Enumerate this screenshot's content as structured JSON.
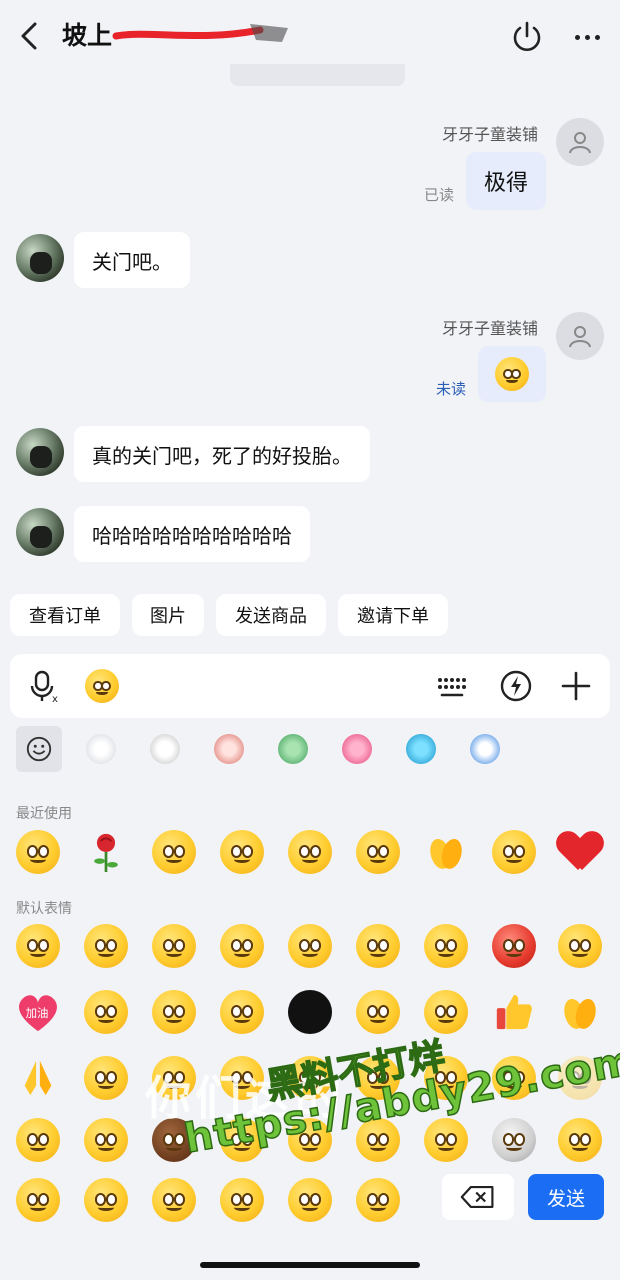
{
  "header": {
    "title": "坡上",
    "back_icon": "chevron-left-icon",
    "power_icon": "power-icon",
    "more_icon": "more-dots-icon"
  },
  "messages": [
    {
      "side": "right",
      "sender": "牙牙子童装铺",
      "text": "极得",
      "status": "已读",
      "status_color": "#888888"
    },
    {
      "side": "left",
      "text": "关门吧。"
    },
    {
      "side": "right",
      "sender": "牙牙子童装铺",
      "emoji": "smile-emoji",
      "status": "未读",
      "status_color": "#2a5fb8"
    },
    {
      "side": "left",
      "text": "真的关门吧，死了的好投胎。"
    },
    {
      "side": "left",
      "text": "哈哈哈哈哈哈哈哈哈哈"
    }
  ],
  "quick_actions": [
    "查看订单",
    "图片",
    "发送商品",
    "邀请下单"
  ],
  "input_bar": {
    "voice_icon": "voice-input-icon",
    "emoji_icon": "emoji-icon",
    "keyboard_icon": "keyboard-icon",
    "flash_icon": "quick-reply-icon",
    "plus_icon": "plus-icon"
  },
  "emoji_panel": {
    "recent_label": "最近使用",
    "default_label": "默认表情",
    "backspace_icon": "backspace-icon",
    "send_label": "发送"
  },
  "watermark": {
    "line1": "黑料不打烊",
    "line2": "https://abdy29.com",
    "ghost_text": "你们这的"
  },
  "colors": {
    "accent": "#1b6ef3",
    "bubble_right": "#e6ecfb",
    "background": "#f2f3f7"
  }
}
